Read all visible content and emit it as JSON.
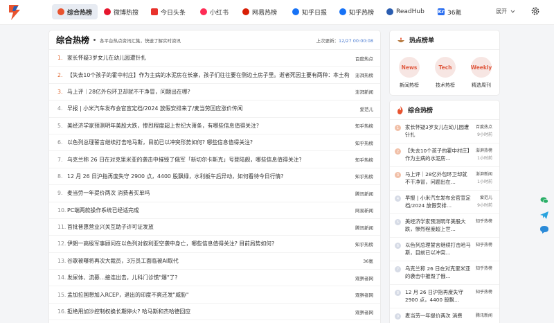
{
  "nav": {
    "items": [
      {
        "label": "综合热榜",
        "icon": "flame-icon",
        "color": "#e8532f"
      },
      {
        "label": "微博热搜",
        "icon": "weibo-icon",
        "color": "#e6162d"
      },
      {
        "label": "今日头条",
        "icon": "toutiao-icon",
        "color": "#e8322c"
      },
      {
        "label": "小红书",
        "icon": "xiaohongshu-icon",
        "color": "#fe2c55"
      },
      {
        "label": "网易热榜",
        "icon": "netease-icon",
        "color": "#d81e06"
      },
      {
        "label": "知乎日报",
        "icon": "zhihu-daily-icon",
        "color": "#1772f6"
      },
      {
        "label": "知乎热榜",
        "icon": "zhihu-icon",
        "color": "#1772f6"
      },
      {
        "label": "ReadHub",
        "icon": "readhub-icon",
        "color": "#2a5db0"
      },
      {
        "label": "36氪",
        "icon": "36kr-icon",
        "color": "#2a6ef0",
        "icon_text": "Kr"
      }
    ],
    "more_label": "展开",
    "more_icon": "chevron-down-icon",
    "settings_icon": "gear-icon"
  },
  "main": {
    "title": "综合热榜",
    "subtitle": "各平台热点资讯汇集，快速了解实时资讯",
    "update_label": "上次更新：",
    "update_time": "12/27 00:00:08",
    "rows": [
      {
        "num": "1.",
        "title": "家长怀疑3岁女儿在幼儿园遭针扎",
        "source": "百度热点"
      },
      {
        "num": "2.",
        "title": "【失去10个孩子的霍中村庄】作为主病的水泥房在长寨，孩子们往往要在侧边土房子里。逝者死因主要有两种：本土构造…",
        "source": "澎湃热榜"
      },
      {
        "num": "3.",
        "title": "马上评｜28亿外包环卫却就不干净冒，问题出在哪?",
        "source": "澎湃新闻"
      },
      {
        "num": "4.",
        "title": "早报 | 小米汽车发布会官宣定档/2024 放假安排来了/麦当劳回应涨价传闻",
        "source": "爱范儿"
      },
      {
        "num": "5.",
        "title": "美经济学家预测明年美股大跌，惨烈程度超上世纪大萧条，有哪些信息值得关注?",
        "source": "知乎热榜"
      },
      {
        "num": "6.",
        "title": "以色列总理誓言继续打击哈马斯，目前已以冲突形势如何? 哪些信息值得关注?",
        "source": "知乎热榜"
      },
      {
        "num": "7.",
        "title": "乌克兰称 26 日在对克里米亚的袭击中摧毁了俄军「新切尔卡斯克」号登陆舰，哪些信息值得关注?",
        "source": "知乎热榜"
      },
      {
        "num": "8.",
        "title": "12 月 26 日沪指再度失守 2900 点，4400 股飘绿，水利板午后异动，如何看待今日行情?",
        "source": "知乎热榜"
      },
      {
        "num": "9.",
        "title": "麦当劳一年提价两次 消费者买单吗",
        "source": "腾讯新闻"
      },
      {
        "num": "10.",
        "title": "PC端两款操作系统已经适完成",
        "source": "网易新闻"
      },
      {
        "num": "11.",
        "title": "首批普惠营业兴关互助子许可证发放",
        "source": "腾讯新闻"
      },
      {
        "num": "12.",
        "title": "伊朗一高级军事顾问在以色列对叙利亚空袭中身亡，哪些信息值得关注? 目前局势如何?",
        "source": "知乎热榜"
      },
      {
        "num": "13.",
        "title": "谷歌被曝将再次大裁员，3万员工面临被AI取代",
        "source": "36氪"
      },
      {
        "num": "14.",
        "title": "发尿体、流募…接连出击，儿科门诊慌\"爆\"了?",
        "source": "观察者网"
      },
      {
        "num": "15.",
        "title": "孟加拉国想加入RCEP，退出的印度不爽还发\"威胁\"",
        "source": "观察者网"
      },
      {
        "num": "16.",
        "title": "拒绝用加沙控制权换长期停火? 哈马斯和杰哈德回应",
        "source": "观察者网"
      }
    ]
  },
  "hot_list": {
    "title": "热点榜单",
    "icon": "fire-bowl-icon",
    "items": [
      {
        "bubble": "News",
        "label": "新闻热榜"
      },
      {
        "bubble": "Tech",
        "label": "技术热榜"
      },
      {
        "bubble": "Weekly",
        "label": "精选周刊"
      }
    ]
  },
  "side": {
    "title": "综合热榜",
    "icon": "flame-icon",
    "rows": [
      {
        "num": "1",
        "title": "家长怀疑3岁女儿在幼儿园遭针扎",
        "source": "百度热点",
        "time": "9小时前"
      },
      {
        "num": "2",
        "title": "【失去10个孩子的霍中村庄】作为主病的水泥房…",
        "source": "澎湃热榜",
        "time": "1小时前"
      },
      {
        "num": "3",
        "title": "马上评｜28亿外包环卫却就不干净冒，问题出在…",
        "source": "澎湃新闻",
        "time": "1小时前"
      },
      {
        "num": "4",
        "title": "早报 | 小米汽车发布会官宣定档/2024 放假安排…",
        "source": "爱范儿",
        "time": "9小时前"
      },
      {
        "num": "5",
        "title": "美经济学家预测明年美股大跌，惨烈程度超上世…",
        "source": "知乎热榜",
        "time": ""
      },
      {
        "num": "6",
        "title": "以色列总理誓言继续打击哈马斯，目前已以冲突…",
        "source": "知乎热榜",
        "time": ""
      },
      {
        "num": "7",
        "title": "乌克兰称 26 日在对克里米亚的袭击中摧毁了俄…",
        "source": "知乎热榜",
        "time": ""
      },
      {
        "num": "8",
        "title": "12 月 26 日沪指再度失守 2900 点，4400 股飘…",
        "source": "知乎热榜",
        "time": ""
      },
      {
        "num": "9",
        "title": "麦当劳一年提价两次 消费",
        "source": "腾讯新闻",
        "time": ""
      }
    ]
  },
  "floating": [
    {
      "icon": "wechat-icon",
      "color": "#2aae67"
    },
    {
      "icon": "telegram-icon",
      "color": "#2aa3de"
    },
    {
      "icon": "chat-icon",
      "color": "#2a8ad8"
    }
  ]
}
